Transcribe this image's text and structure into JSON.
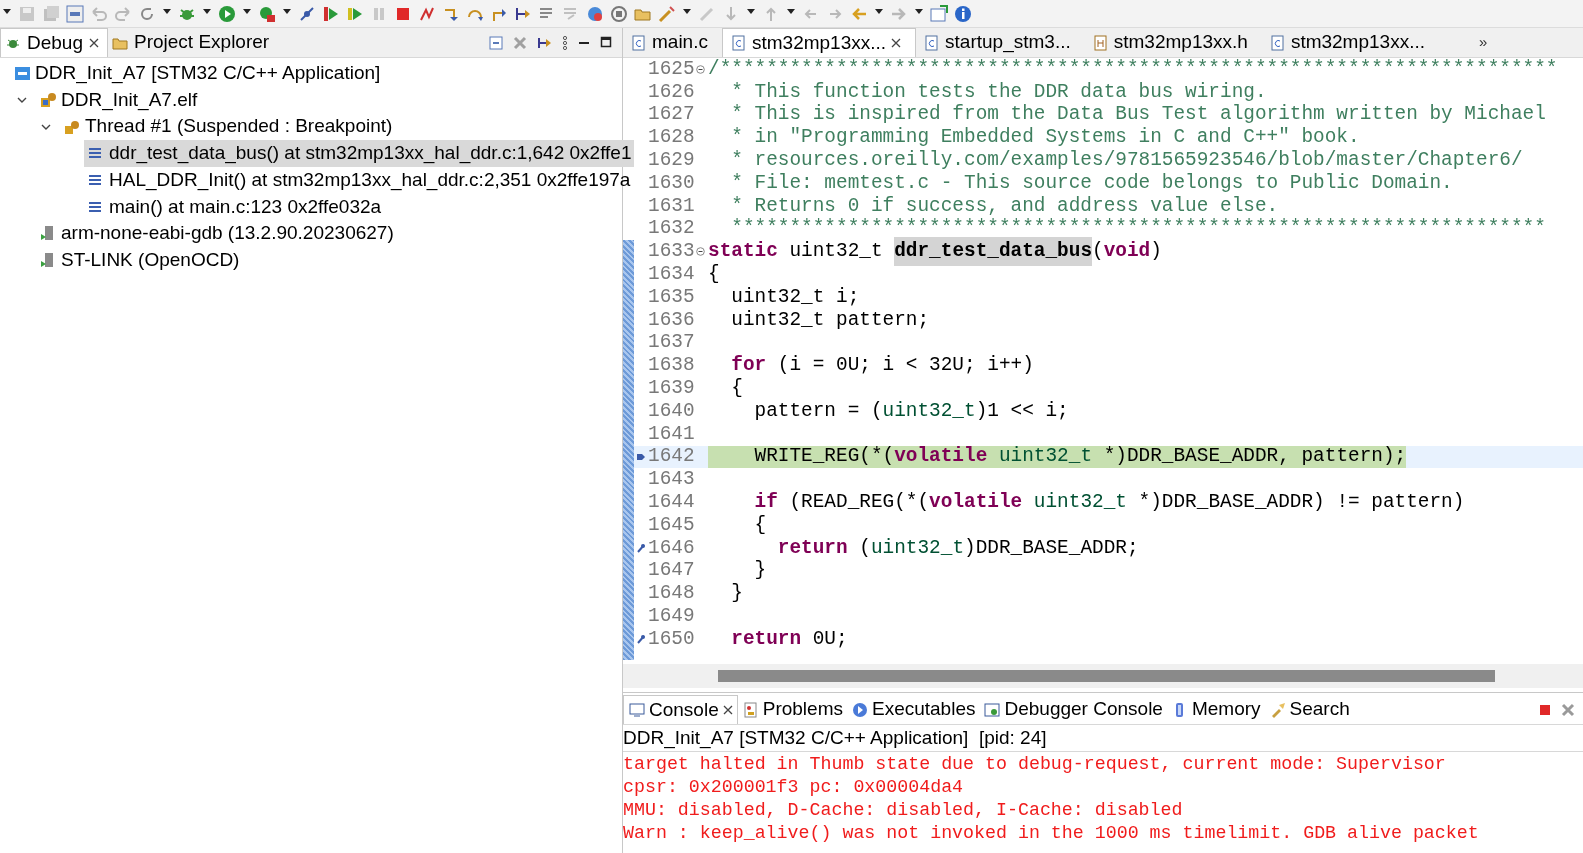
{
  "view_tabs": [
    {
      "label": "Debug",
      "selected": true,
      "closable": true,
      "kind": "debug"
    },
    {
      "label": "Project Explorer",
      "selected": false,
      "closable": false,
      "kind": "folder"
    }
  ],
  "debug_tree": [
    {
      "label": "DDR_Init_A7 [STM32 C/C++ Application]",
      "kind": "launch",
      "selected": false,
      "children": [
        {
          "label": "DDR_Init_A7.elf",
          "kind": "process",
          "selected": false,
          "expanded": true,
          "children": [
            {
              "label": "Thread #1 (Suspended : Breakpoint)",
              "kind": "thread",
              "selected": false,
              "expanded": true,
              "children": [
                {
                  "label": "ddr_test_data_bus() at stm32mp13xx_hal_ddr.c:1,642 0x2ffe1",
                  "kind": "frame",
                  "selected": true
                },
                {
                  "label": "HAL_DDR_Init() at stm32mp13xx_hal_ddr.c:2,351 0x2ffe197a",
                  "kind": "frame",
                  "selected": false
                },
                {
                  "label": "main() at main.c:123 0x2ffe032a",
                  "kind": "frame",
                  "selected": false
                }
              ]
            }
          ]
        },
        {
          "label": "arm-none-eabi-gdb (13.2.90.20230627)",
          "kind": "gdb",
          "selected": false
        },
        {
          "label": "ST-LINK (OpenOCD)",
          "kind": "gdb",
          "selected": false
        }
      ]
    }
  ],
  "editor": {
    "tabs": [
      {
        "label": "main.c",
        "selected": false,
        "closable": false,
        "kind": "c"
      },
      {
        "label": "stm32mp13xx...",
        "selected": true,
        "closable": true,
        "kind": "c"
      },
      {
        "label": "startup_stm3...",
        "selected": false,
        "closable": false,
        "kind": "c"
      },
      {
        "label": "stm32mp13xx.h",
        "selected": false,
        "closable": false,
        "kind": "h"
      },
      {
        "label": "stm32mp13xx...",
        "selected": false,
        "closable": false,
        "kind": "c"
      }
    ],
    "overflow": "»",
    "lines": [
      {
        "number": "1625",
        "fold": true,
        "tokens": [
          {
            "kind": "comment",
            "text": "/************************************************************************"
          }
        ]
      },
      {
        "number": "1626",
        "tokens": [
          {
            "kind": "comment",
            "text": "  * This function tests the DDR data bus wiring."
          }
        ]
      },
      {
        "number": "1627",
        "tokens": [
          {
            "kind": "comment",
            "text": "  * This is inspired from the Data Bus Test algorithm written by Michael"
          }
        ]
      },
      {
        "number": "1628",
        "tokens": [
          {
            "kind": "comment",
            "text": "  * in \"Programming Embedded Systems in C and C++\" book."
          }
        ]
      },
      {
        "number": "1629",
        "tokens": [
          {
            "kind": "comment",
            "text": "  * resources.oreilly.com/examples/9781565923546/blob/master/Chapter6/"
          }
        ]
      },
      {
        "number": "1630",
        "tokens": [
          {
            "kind": "comment",
            "text": "  * File: memtest.c - This source code belongs to Public Domain."
          }
        ]
      },
      {
        "number": "1631",
        "tokens": [
          {
            "kind": "comment",
            "text": "  * Returns 0 if success, and address value else."
          }
        ]
      },
      {
        "number": "1632",
        "tokens": [
          {
            "kind": "comment",
            "text": "  **********************************************************************"
          }
        ]
      },
      {
        "number": "1633",
        "fold": true,
        "tokens": [
          {
            "kind": "keyword",
            "text": "static"
          },
          {
            "kind": "plain",
            "text": " uint32_t "
          },
          {
            "kind": "symbol",
            "text": "ddr_test_data_bus"
          },
          {
            "kind": "plain",
            "text": "("
          },
          {
            "kind": "keyword",
            "text": "void"
          },
          {
            "kind": "plain",
            "text": ")"
          }
        ]
      },
      {
        "number": "1634",
        "tokens": [
          {
            "kind": "plain",
            "text": "{"
          }
        ]
      },
      {
        "number": "1635",
        "tokens": [
          {
            "kind": "plain",
            "text": "  uint32_t i;"
          }
        ]
      },
      {
        "number": "1636",
        "tokens": [
          {
            "kind": "plain",
            "text": "  uint32_t pattern;"
          }
        ]
      },
      {
        "number": "1637"
      },
      {
        "number": "1638",
        "tokens": [
          {
            "kind": "keyword",
            "text": "  for"
          },
          {
            "kind": "plain",
            "text": " (i = 0U; i < 32U; i++)"
          }
        ]
      },
      {
        "number": "1639",
        "tokens": [
          {
            "kind": "plain",
            "text": "  {"
          }
        ]
      },
      {
        "number": "1640",
        "tokens": [
          {
            "kind": "plain",
            "text": "    pattern = ("
          },
          {
            "kind": "type",
            "text": "uint32_t"
          },
          {
            "kind": "plain",
            "text": ")1 << i;"
          }
        ]
      },
      {
        "number": "1641"
      },
      {
        "number": "1642",
        "current": true,
        "kind": "pointer",
        "tokens": [
          {
            "kind": "plain",
            "text": "    WRITE_REG(*("
          },
          {
            "kind": "keyword",
            "text": "volatile "
          },
          {
            "kind": "type",
            "text": "uint32_t"
          },
          {
            "kind": "plain",
            "text": " *)DDR_BASE_ADDR, pattern);"
          }
        ]
      },
      {
        "number": "1643"
      },
      {
        "number": "1644",
        "tokens": [
          {
            "kind": "keyword",
            "text": "    if"
          },
          {
            "kind": "plain",
            "text": " (READ_REG(*("
          },
          {
            "kind": "keyword",
            "text": "volatile "
          },
          {
            "kind": "type",
            "text": "uint32_t"
          },
          {
            "kind": "plain",
            "text": " *)DDR_BASE_ADDR) != pattern)"
          }
        ]
      },
      {
        "number": "1645",
        "tokens": [
          {
            "kind": "plain",
            "text": "    {"
          }
        ]
      },
      {
        "number": "1646",
        "kind": "link",
        "tokens": [
          {
            "kind": "keyword",
            "text": "      return"
          },
          {
            "kind": "plain",
            "text": " ("
          },
          {
            "kind": "type",
            "text": "uint32_t"
          },
          {
            "kind": "plain",
            "text": ")DDR_BASE_ADDR;"
          }
        ]
      },
      {
        "number": "1647",
        "tokens": [
          {
            "kind": "plain",
            "text": "    }"
          }
        ]
      },
      {
        "number": "1648",
        "tokens": [
          {
            "kind": "plain",
            "text": "  }"
          }
        ]
      },
      {
        "number": "1649"
      },
      {
        "number": "1650",
        "kind": "link",
        "tokens": [
          {
            "kind": "keyword",
            "text": "  return"
          },
          {
            "kind": "plain",
            "text": " 0U;"
          }
        ]
      }
    ]
  },
  "console": {
    "tabs": [
      {
        "label": "Console",
        "selected": true,
        "closable": true,
        "kind": "console"
      },
      {
        "label": "Problems",
        "selected": false,
        "closable": false,
        "kind": "problems"
      },
      {
        "label": "Executables",
        "selected": false,
        "closable": false,
        "kind": "exec"
      },
      {
        "label": "Debugger Console",
        "selected": false,
        "closable": false,
        "kind": "dbgconsole"
      },
      {
        "label": "Memory",
        "selected": false,
        "closable": false,
        "kind": "memory"
      },
      {
        "label": "Search",
        "selected": false,
        "closable": false,
        "kind": "search"
      }
    ],
    "header": "DDR_Init_A7 [STM32 C/C++ Application]  [pid: 24]",
    "output": [
      "target halted in Thumb state due to debug-request, current mode: Supervisor",
      "cpsr: 0x200001f3 pc: 0x00004da4",
      "MMU: disabled, D-Cache: disabled, I-Cache: disabled",
      "Warn : keep_alive() was not invoked in the 1000 ms timelimit. GDB alive packet"
    ]
  }
}
